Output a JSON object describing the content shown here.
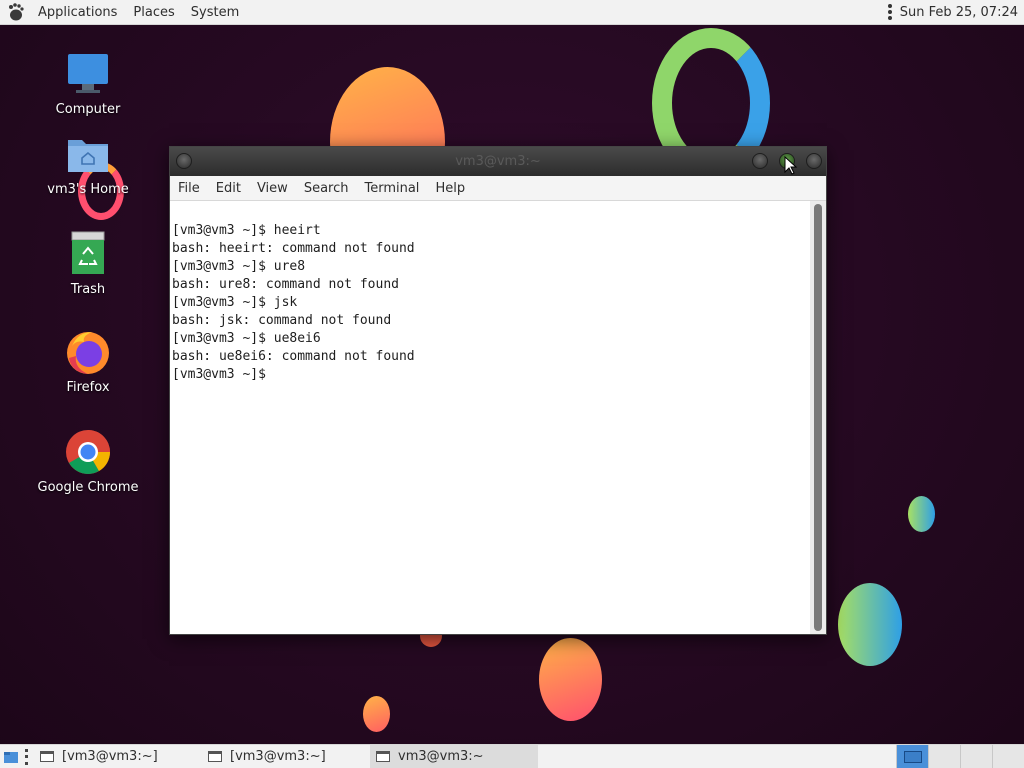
{
  "top_panel": {
    "menus": [
      "Applications",
      "Places",
      "System"
    ],
    "clock": "Sun Feb 25, 07:24"
  },
  "desktop": {
    "icons": [
      {
        "label": "Computer",
        "icon": "computer-icon"
      },
      {
        "label": "vm3's Home",
        "icon": "home-folder-icon"
      },
      {
        "label": "Trash",
        "icon": "trash-icon"
      },
      {
        "label": "Firefox",
        "icon": "firefox-icon"
      },
      {
        "label": "Google Chrome",
        "icon": "chrome-icon"
      }
    ]
  },
  "terminal": {
    "title": "vm3@vm3:~",
    "menu": [
      "File",
      "Edit",
      "View",
      "Search",
      "Terminal",
      "Help"
    ],
    "lines": [
      "[vm3@vm3 ~]$ heeirt",
      "bash: heeirt: command not found",
      "[vm3@vm3 ~]$ ure8",
      "bash: ure8: command not found",
      "[vm3@vm3 ~]$ jsk",
      "bash: jsk: command not found",
      "[vm3@vm3 ~]$ ue8ei6",
      "bash: ue8ei6: command not found",
      "[vm3@vm3 ~]$ "
    ]
  },
  "taskbar": {
    "tasks": [
      {
        "label": "[vm3@vm3:~]",
        "active": false
      },
      {
        "label": "[vm3@vm3:~]",
        "active": false
      },
      {
        "label": "vm3@vm3:~",
        "active": true
      }
    ],
    "workspace_count": 4,
    "active_workspace": 1
  },
  "colors": {
    "desktop_bg": "#2a0a24",
    "panel_bg": "#f2f2f2",
    "workspace_active": "#4a90d9"
  }
}
